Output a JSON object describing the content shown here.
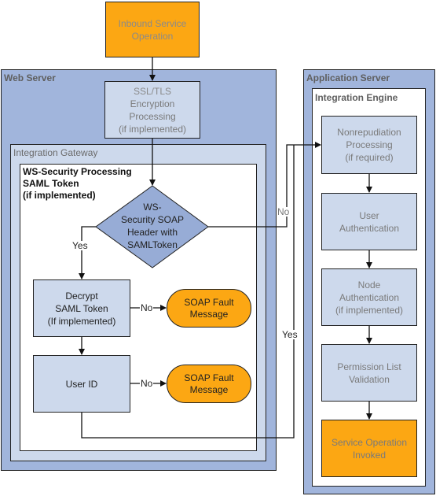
{
  "diagram": {
    "inbound": {
      "lines": [
        "Inbound Service",
        "Operation"
      ]
    },
    "web_server": {
      "title": "Web Server"
    },
    "ssl_box": {
      "lines": [
        "SSL/TLS",
        "Encryption",
        "Processing",
        "(if implemented)"
      ]
    },
    "integration_gateway": {
      "title": "Integration Gateway"
    },
    "ws_security": {
      "title_lines": [
        "WS-Security Processing",
        "SAML Token",
        "(if implemented)"
      ]
    },
    "decision": {
      "lines": [
        "WS-",
        "Security SOAP",
        "Header with",
        "SAMLToken"
      ]
    },
    "decrypt_box": {
      "lines": [
        "Decrypt",
        "SAML Token",
        "(If implemented)"
      ]
    },
    "user_id_box": {
      "label": "User ID"
    },
    "fault1": {
      "lines": [
        "SOAP Fault",
        "Message"
      ]
    },
    "fault2": {
      "lines": [
        "SOAP Fault",
        "Message"
      ]
    },
    "edge_labels": {
      "yes_decision": "Yes",
      "no_decision": "No",
      "no_decrypt": "No",
      "no_userid": "No",
      "yes_userid": "Yes"
    },
    "app_server": {
      "title": "Application Server"
    },
    "integration_engine": {
      "title": "Integration Engine"
    },
    "engine_steps": [
      {
        "lines": [
          "Nonrepudiation",
          "Processing",
          "(if required)"
        ]
      },
      {
        "lines": [
          "User",
          "Authentication"
        ]
      },
      {
        "lines": [
          "Node",
          "Authentication",
          "(if implemented)"
        ]
      },
      {
        "lines": [
          "Permission List",
          "Validation"
        ]
      },
      {
        "lines": [
          "Service Operation",
          "Invoked"
        ]
      }
    ],
    "colors": {
      "orange": "#fca713",
      "server_blue": "#a1b5dc",
      "light_blue": "#cdd9ec",
      "decision_blue": "#97acd6"
    }
  }
}
